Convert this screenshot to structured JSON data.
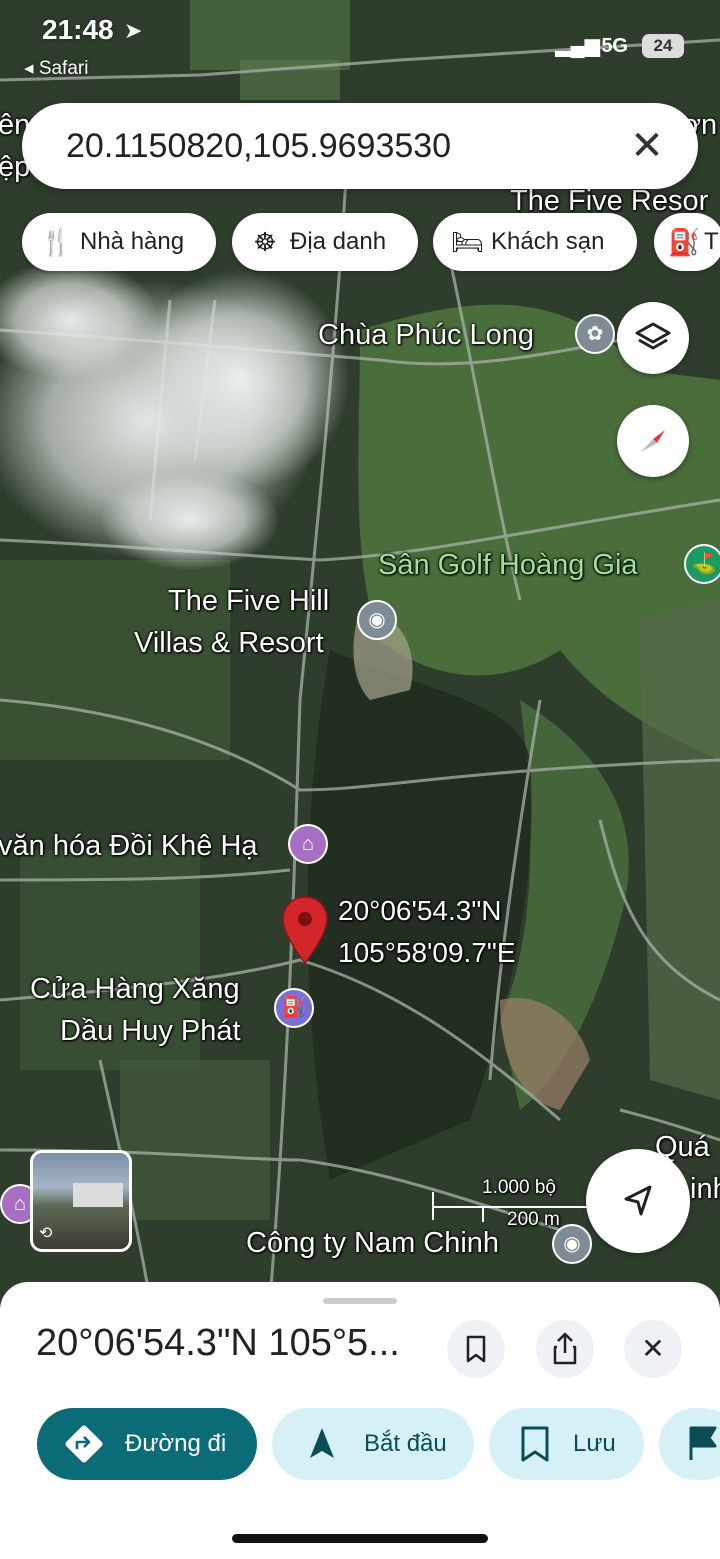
{
  "status_bar": {
    "time": "21:48",
    "back_label": "◂ Safari",
    "network": "5G",
    "battery": "24"
  },
  "search": {
    "query": "20.1150820,105.9693530"
  },
  "chips": [
    {
      "icon": "restaurant-icon",
      "label": "Nhà hàng"
    },
    {
      "icon": "landmark-icon",
      "label": "Địa danh"
    },
    {
      "icon": "hotel-icon",
      "label": "Khách sạn"
    },
    {
      "icon": "gas-icon",
      "label": "T"
    }
  ],
  "map": {
    "labels": {
      "pagoda": "Chùa Phúc Long",
      "golf": "Sân Golf Hoàng Gia",
      "resort_line1": "The Five Hill",
      "resort_line2": "Villas & Resort",
      "resort_top": "The Five Resor",
      "culture": "văn hóa Đồi Khê Hạ",
      "pin_lat": "20°06'54.3\"N",
      "pin_lng": "105°58'09.7\"E",
      "gas_line1": "Cửa Hàng Xăng",
      "gas_line2": "Dầu Huy Phát",
      "company": "Công ty Nam Chinh",
      "qua": "Quá",
      "inh": "inh",
      "left_edge1": "ên",
      "left_edge2": "ệp",
      "top_right": "ợn"
    },
    "scale": {
      "imperial": "1.000 bộ",
      "metric": "200 m"
    }
  },
  "sheet": {
    "title": "20°06'54.3\"N 105°5...",
    "actions": [
      {
        "label": "Đường đi",
        "style": "primary",
        "color": "#0b6b77"
      },
      {
        "label": "Bắt đầu",
        "style": "secondary"
      },
      {
        "label": "Lưu",
        "style": "secondary"
      }
    ]
  }
}
